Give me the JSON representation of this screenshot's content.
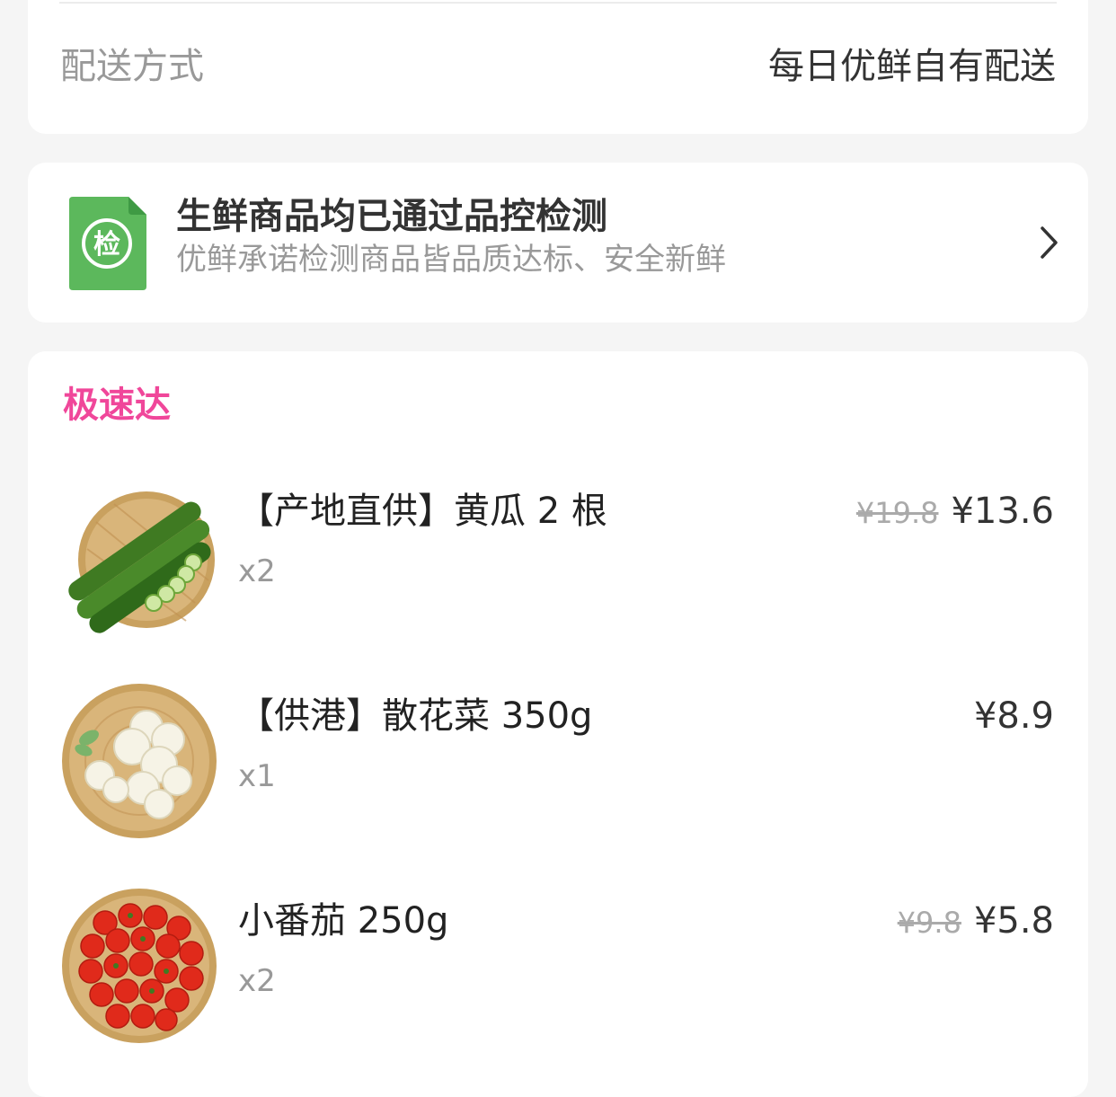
{
  "delivery": {
    "label": "配送方式",
    "value": "每日优鲜自有配送"
  },
  "inspection": {
    "icon": "inspection-doc-icon",
    "icon_char": "检",
    "title": "生鲜商品均已通过品控检测",
    "subtitle": "优鲜承诺检测商品皆品质达标、安全新鲜",
    "colors": {
      "icon_green": "#5cb85c"
    }
  },
  "section": {
    "title": "极速达",
    "accent_color": "#f0479a"
  },
  "products": [
    {
      "name": "【产地直供】黄瓜 2 根",
      "qty": "x2",
      "old_price": "¥19.8",
      "price": "¥13.6",
      "thumb": "cucumber-image"
    },
    {
      "name": "【供港】散花菜 350g",
      "qty": "x1",
      "old_price": "",
      "price": "¥8.9",
      "thumb": "cauliflower-image"
    },
    {
      "name": "小番茄 250g",
      "qty": "x2",
      "old_price": "¥9.8",
      "price": "¥5.8",
      "thumb": "cherry-tomato-image"
    }
  ]
}
